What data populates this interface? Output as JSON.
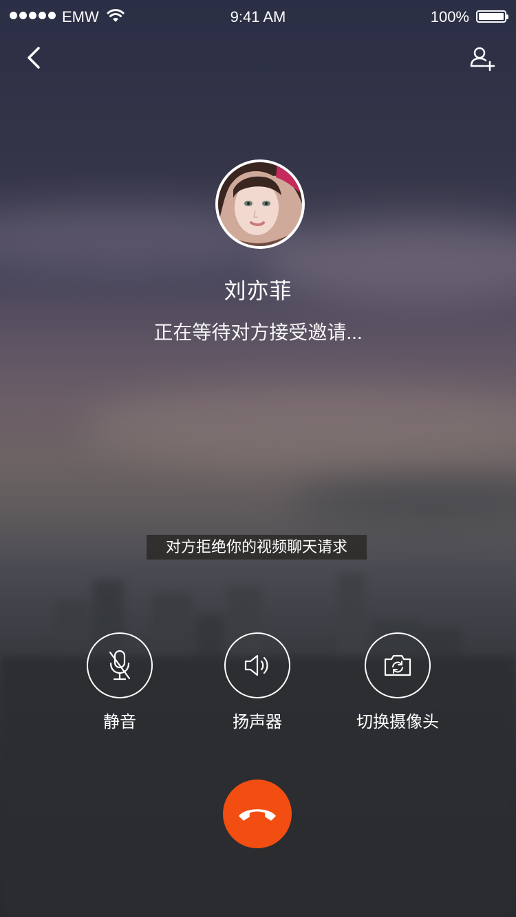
{
  "status_bar": {
    "carrier": "EMW",
    "time": "9:41 AM",
    "battery_percent": "100%",
    "signal_bars": 5
  },
  "nav": {
    "back_icon": "chevron-left-icon",
    "add_contact_icon": "add-person-icon"
  },
  "caller": {
    "name": "刘亦菲",
    "status": "正在等待对方接受邀请..."
  },
  "toast": {
    "message": "对方拒绝你的视频聊天请求"
  },
  "controls": {
    "mute_label": "静音",
    "mute_icon": "microphone-off-icon",
    "speaker_label": "扬声器",
    "speaker_icon": "speaker-icon",
    "camera_label": "切换摄像头",
    "camera_icon": "switch-camera-icon"
  },
  "hangup": {
    "icon": "phone-hangup-icon",
    "color": "#f24e12"
  }
}
